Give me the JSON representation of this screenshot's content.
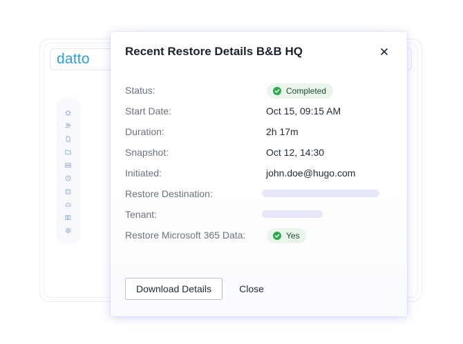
{
  "background": {
    "logo_text": "datto",
    "sidebar_icons": [
      "home-icon",
      "users-icon",
      "file-icon",
      "folder-icon",
      "server-icon",
      "clock-icon",
      "building-icon",
      "cloud-icon",
      "grid-icon",
      "gear-icon"
    ]
  },
  "modal": {
    "title": "Recent Restore Details B&B HQ",
    "close_icon": "close-icon",
    "rows": {
      "status": {
        "label": "Status:",
        "value": "Completed"
      },
      "start_date": {
        "label": "Start Date:",
        "value": "Oct 15, 09:15 AM"
      },
      "duration": {
        "label": "Duration:",
        "value": "2h 17m"
      },
      "snapshot": {
        "label": "Snapshot:",
        "value": "Oct 12, 14:30"
      },
      "initiated": {
        "label": "Initiated:",
        "value": "john.doe@hugo.com"
      },
      "restore_destination": {
        "label": "Restore Destination:"
      },
      "tenant": {
        "label": "Tenant:"
      },
      "restore_m365": {
        "label": "Restore Microsoft 365 Data:",
        "value": "Yes"
      }
    },
    "buttons": {
      "download": "Download Details",
      "close": "Close"
    }
  },
  "colors": {
    "logo": "#2a9fd8",
    "success_icon": "#2fa84f",
    "success_bg": "#eaf6ec",
    "placeholder_bar": "#e6e8fa"
  }
}
